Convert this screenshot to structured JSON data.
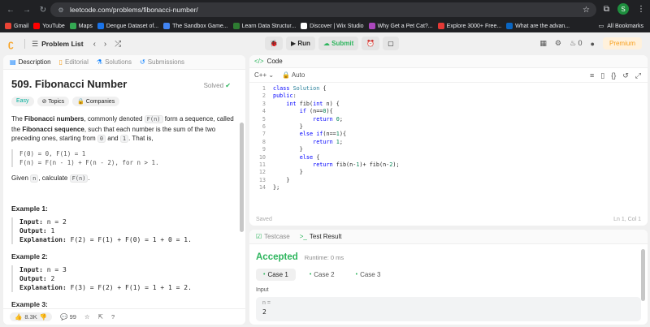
{
  "browser": {
    "url": "leetcode.com/problems/fibonacci-number/",
    "profile_initial": "S"
  },
  "bookmarks": [
    {
      "label": "Gmail",
      "color": "#ea4335"
    },
    {
      "label": "YouTube",
      "color": "#ff0000"
    },
    {
      "label": "Maps",
      "color": "#34a853"
    },
    {
      "label": "Dengue Dataset of...",
      "color": "#1a73e8"
    },
    {
      "label": "The Sandbox Game...",
      "color": "#4285f4"
    },
    {
      "label": "Learn Data Structur...",
      "color": "#2e7d32"
    },
    {
      "label": "Discover | Wix Studio",
      "color": "#ffffff"
    },
    {
      "label": "Why Get a Pet Cat?...",
      "color": "#ab47bc"
    },
    {
      "label": "Explore 3000+ Free...",
      "color": "#e53935"
    },
    {
      "label": "What are the advan...",
      "color": "#0a66c2"
    }
  ],
  "bookmarks_all": "All Bookmarks",
  "header": {
    "problem_list": "Problem List",
    "run": "Run",
    "submit": "Submit",
    "streak_count": "0",
    "premium": "Premium"
  },
  "left": {
    "tabs": [
      "Description",
      "Editorial",
      "Solutions",
      "Submissions"
    ],
    "title": "509. Fibonacci Number",
    "solved": "Solved",
    "chips": [
      "Easy",
      "Topics",
      "Companies"
    ],
    "desc": {
      "p1_a": "The ",
      "p1_b": "Fibonacci numbers",
      "p1_c": ", commonly denoted ",
      "p1_code": "F(n)",
      "p1_d": " form a sequence, called the ",
      "p1_e": "Fibonacci sequence",
      "p1_f": ", such that each number is the sum of the two preceding ones, starting from ",
      "p1_code0": "0",
      "p1_g": " and ",
      "p1_code1": "1",
      "p1_h": ". That is,",
      "formula1": "F(0) = 0, F(1) = 1",
      "formula2": "F(n) = F(n - 1) + F(n - 2), for n > 1.",
      "given_a": "Given ",
      "given_code": "n",
      "given_b": ", calculate ",
      "given_code2": "F(n)",
      "given_c": "."
    },
    "examples": [
      {
        "title": "Example 1:",
        "input": "n = 2",
        "output": "1",
        "explanation": "F(2) = F(1) + F(0) = 1 + 0 = 1."
      },
      {
        "title": "Example 2:",
        "input": "n = 3",
        "output": "2",
        "explanation": "F(3) = F(2) + F(1) = 1 + 1 = 2."
      },
      {
        "title": "Example 3:"
      }
    ],
    "labels": {
      "input": "Input:",
      "output": "Output:",
      "explanation": "Explanation:"
    },
    "footer": {
      "likes": "8.3K",
      "comments": "99"
    }
  },
  "code": {
    "tab": "Code",
    "language": "C++",
    "mode": "Auto",
    "lines": [
      "class Solution {",
      "public:",
      "    int fib(int n) {",
      "        if (n==0){",
      "            return 0;",
      "        }",
      "        else if(n==1){",
      "            return 1;",
      "        }",
      "        else {",
      "            return fib(n-1)+ fib(n-2);",
      "        }",
      "    }",
      "};"
    ],
    "status": "Saved",
    "cursor": "Ln 1, Col 1"
  },
  "result": {
    "tabs": [
      "Testcase",
      "Test Result"
    ],
    "status": "Accepted",
    "runtime": "Runtime: 0 ms",
    "cases": [
      "Case 1",
      "Case 2",
      "Case 3"
    ],
    "input_label": "Input",
    "input_key": "n =",
    "input_value": "2"
  }
}
